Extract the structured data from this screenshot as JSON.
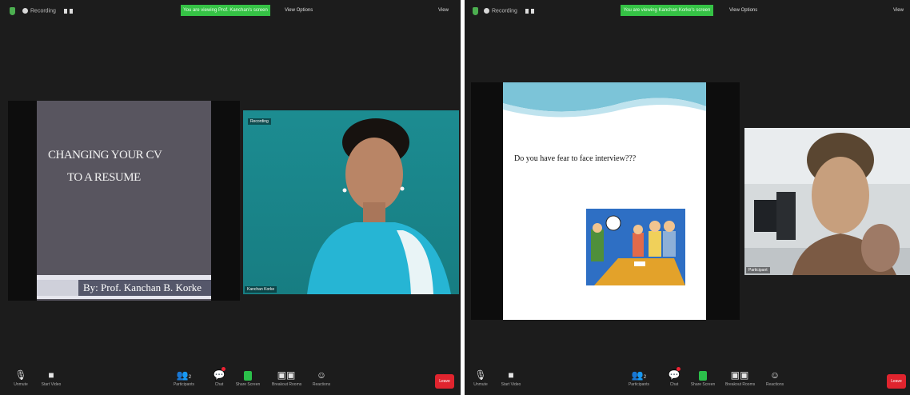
{
  "left_window": {
    "recording_label": "Recording",
    "banner_text": "You are viewing Prof. Kanchan's screen",
    "view_options_label": "View Options",
    "view_button_label": "View",
    "slide": {
      "title_line1": "CHANGING YOUR CV",
      "title_line2": "TO A RESUME",
      "author": "By: Prof. Kanchan B. Korke"
    },
    "video": {
      "mic_label": "Recording",
      "name": "Kanchan Korke"
    },
    "toolbar": {
      "mute": "Unmute",
      "video": "Start Video",
      "participants": "Participants",
      "participants_count": "2",
      "chat": "Chat",
      "share": "Share Screen",
      "breakout": "Breakout Rooms",
      "reactions": "Reactions",
      "end": "Leave"
    }
  },
  "right_window": {
    "recording_label": "Recording",
    "banner_text": "You are viewing Kanchan Korke's screen",
    "view_options_label": "View Options",
    "view_button_label": "View",
    "slide": {
      "question": "Do you have fear to face interview???"
    },
    "video": {
      "name": "Participant"
    },
    "toolbar": {
      "mute": "Unmute",
      "video": "Start Video",
      "participants": "Participants",
      "participants_count": "2",
      "chat": "Chat",
      "share": "Share Screen",
      "breakout": "Breakout Rooms",
      "reactions": "Reactions",
      "end": "Leave"
    }
  },
  "colors": {
    "background": "#1c1c1c",
    "banner": "#35c245",
    "slide_left_bg": "#58555f",
    "video_left_bg": "#1f8a8e",
    "end_button": "#e0242e"
  }
}
